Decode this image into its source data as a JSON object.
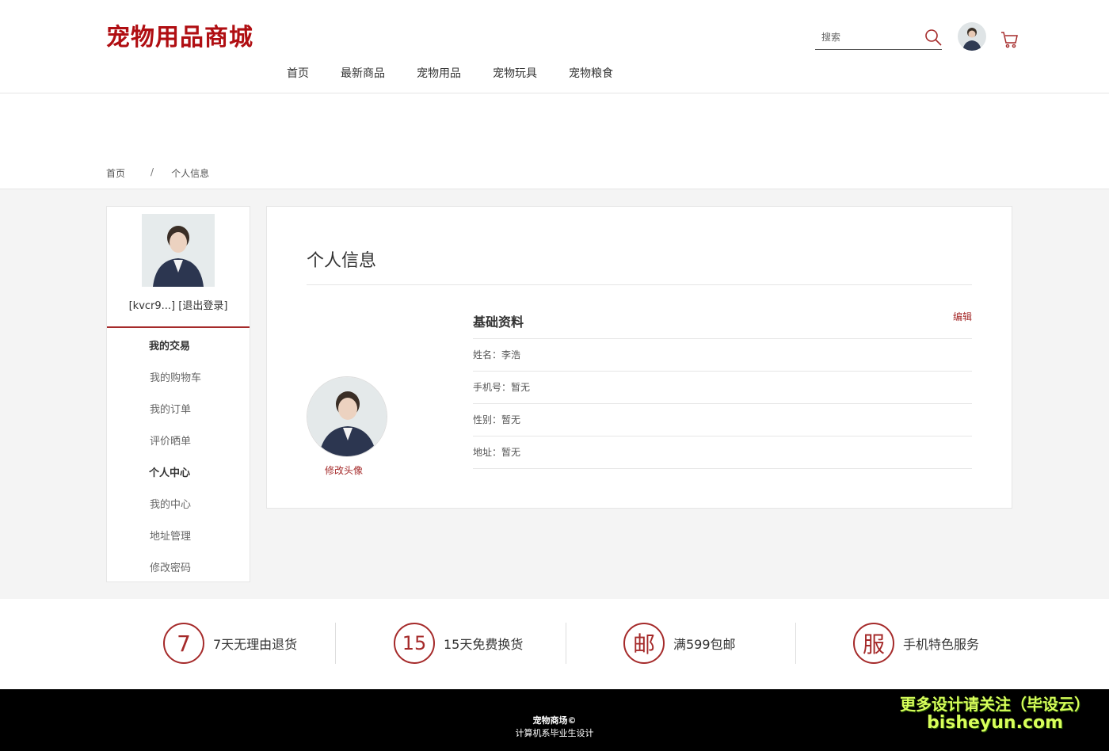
{
  "header": {
    "brand": "宠物用品商城",
    "nav": [
      "首页",
      "最新商品",
      "宠物用品",
      "宠物玩具",
      "宠物粮食"
    ],
    "search_placeholder": "搜索"
  },
  "breadcrumb": {
    "home": "首页",
    "sep": "/",
    "current": "个人信息"
  },
  "sidebar": {
    "user_line": "[kvcr9...] [退出登录]",
    "groups": [
      {
        "title": "我的交易",
        "items": [
          "我的购物车",
          "我的订单",
          "评价晒单"
        ]
      },
      {
        "title": "个人中心",
        "items": [
          "我的中心",
          "地址管理",
          "修改密码"
        ]
      }
    ]
  },
  "content": {
    "title": "个人信息",
    "change_avatar": "修改头像",
    "info_title": "基础资料",
    "edit_label": "编辑",
    "rows": [
      "姓名：李浩",
      "手机号：暂无",
      "性别：暂无",
      "地址：暂无"
    ]
  },
  "services": [
    {
      "mark": "7",
      "label": "7天无理由退货"
    },
    {
      "mark": "15",
      "label": "15天免费换货"
    },
    {
      "mark": "邮",
      "label": "满599包邮"
    },
    {
      "mark": "服",
      "label": "手机特色服务"
    }
  ],
  "footer": {
    "line1": "宠物商场©",
    "line2": "计算机系毕业生设计"
  },
  "watermark": {
    "line1": "更多设计请关注（毕设云）",
    "line2": "bisheyun.com"
  },
  "colors": {
    "accent": "#a52a2a",
    "brand": "#b00e12"
  }
}
